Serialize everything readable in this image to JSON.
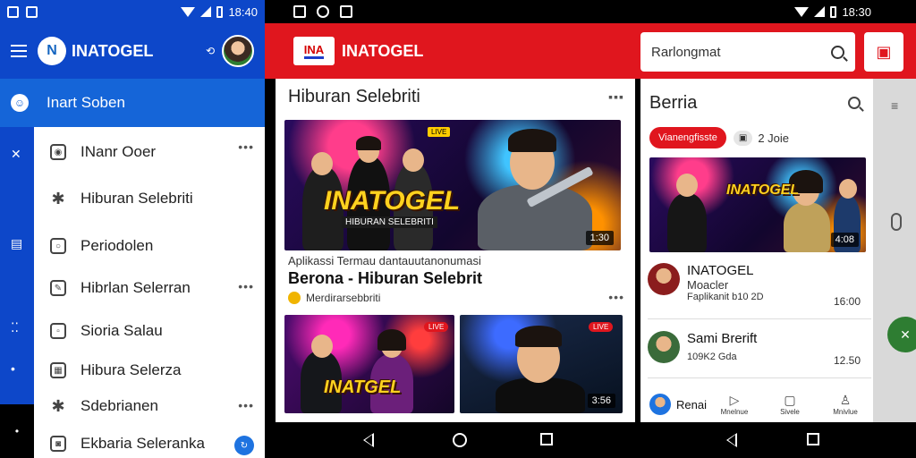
{
  "left": {
    "status_time": "18:40",
    "brand": "INATOGEL",
    "logo_letter": "N",
    "active_item": "Inart Soben",
    "drawer_items": [
      {
        "label": "INanr Ooer",
        "icon": "user-icon",
        "more": true
      },
      {
        "label": "Hiburan Selebriti",
        "icon": "star-icon",
        "more": false
      },
      {
        "label": "Periodolen",
        "icon": "circle-icon",
        "more": false
      },
      {
        "label": "Hibrlan Selerran",
        "icon": "edit-icon",
        "more": true
      },
      {
        "label": "Sioria Salau",
        "icon": "square-icon",
        "more": false
      },
      {
        "label": "Hibura Selerza",
        "icon": "image-icon",
        "more": false
      },
      {
        "label": "Sdebrianen",
        "icon": "star-icon",
        "more": true
      },
      {
        "label": "Ekbaria Seleranka",
        "icon": "camera-icon",
        "badge": true
      }
    ]
  },
  "main": {
    "status_time": "18:30",
    "brand": "INATOGEL",
    "search_value": "Rarlongmat",
    "section_title": "Hiburan Selebriti",
    "featured": {
      "watermark": "INATOGEL",
      "duration": "1:30",
      "subtitle": "Aplikassi Termau dantauutanonumasi",
      "title": "Berona - Hiburan Selebrit",
      "channel": "Merdirarsebbriti"
    },
    "thumbs": [
      {
        "watermark": "INATGEL",
        "duration": ""
      },
      {
        "watermark": "",
        "duration": "3:56"
      }
    ]
  },
  "side": {
    "title": "Berria",
    "chip_red": "Vianengfisste",
    "chip_gray": "2 Joie",
    "video_duration": "4:08",
    "items": [
      {
        "title": "INATOGEL",
        "sub": "Moacler",
        "meta": "Faplikanit b10 2D",
        "time": "16:00"
      },
      {
        "title": "Sami Brerift",
        "sub": "",
        "meta": "109K2 Gda",
        "time": "12.50"
      },
      {
        "title": "Renai",
        "sub": "",
        "meta": "",
        "time": ""
      }
    ],
    "tabs": [
      "Mnelnue",
      "Sivele",
      "Mnivlue"
    ]
  }
}
